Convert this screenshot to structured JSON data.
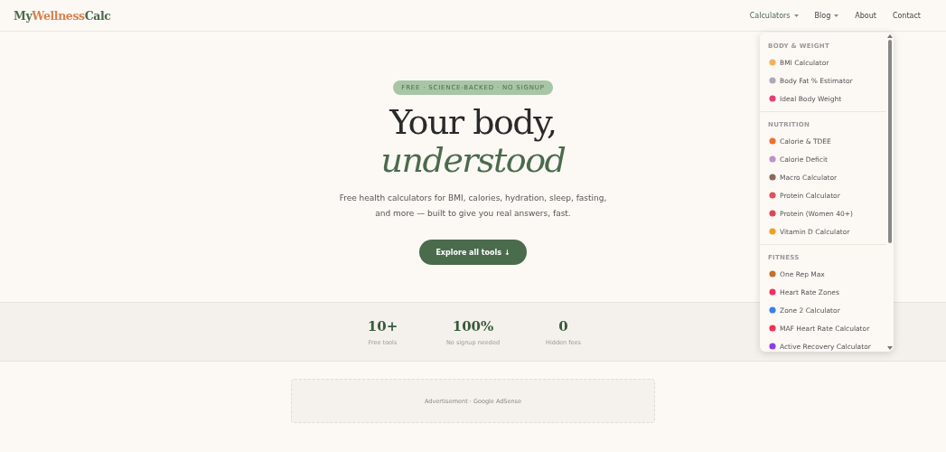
{
  "logo": {
    "parts": [
      {
        "text": "My",
        "color": "#4a6b4c"
      },
      {
        "text": "Wellness",
        "color": "#d9814f"
      },
      {
        "text": "Calc",
        "color": "#4a6b4c"
      }
    ]
  },
  "nav": [
    {
      "label": "Calculators",
      "dropdown": true,
      "expanded": true
    },
    {
      "label": "Blog",
      "dropdown": true,
      "expanded": false
    },
    {
      "label": "About",
      "dropdown": false,
      "expanded": false
    },
    {
      "label": "Contact",
      "dropdown": false,
      "expanded": false
    }
  ],
  "menu": {
    "sections": [
      {
        "heading": "BODY & WEIGHT",
        "items": [
          {
            "label": "BMI Calculator",
            "color": "#f0b060"
          },
          {
            "label": "Body Fat % Estimator",
            "color": "#b0a8b8"
          },
          {
            "label": "Ideal Body Weight",
            "color": "#e0407a"
          }
        ]
      },
      {
        "heading": "NUTRITION",
        "items": [
          {
            "label": "Calorie & TDEE",
            "color": "#f07030"
          },
          {
            "label": "Calorie Deficit",
            "color": "#c090c8"
          },
          {
            "label": "Macro Calculator",
            "color": "#8a6a5a"
          },
          {
            "label": "Protein Calculator",
            "color": "#e05060"
          },
          {
            "label": "Protein (Women 40+)",
            "color": "#d84858"
          },
          {
            "label": "Vitamin D Calculator",
            "color": "#f0a020"
          }
        ]
      },
      {
        "heading": "FITNESS",
        "items": [
          {
            "label": "One Rep Max",
            "color": "#c07030"
          },
          {
            "label": "Heart Rate Zones",
            "color": "#f03060"
          },
          {
            "label": "Zone 2 Calculator",
            "color": "#3a80e8"
          },
          {
            "label": "MAF Heart Rate Calculator",
            "color": "#f03050"
          },
          {
            "label": "Active Recovery Calculator",
            "color": "#8a40e0"
          }
        ]
      }
    ]
  },
  "hero": {
    "badge": "FREE · SCIENCE-BACKED · NO SIGNUP",
    "title": "Your body,",
    "title_accent": "understood",
    "subtitle": "Free health calculators for BMI, calories, hydration, sleep, fasting, and more — built to give you real answers, fast.",
    "button": "Explore all tools ↓"
  },
  "stats": [
    {
      "value": "10+",
      "label": "Free tools"
    },
    {
      "value": "100%",
      "label": "No signup needed"
    },
    {
      "value": "0",
      "label": "Hidden fees"
    }
  ],
  "ad": {
    "label": "Advertisement · Google AdSense"
  }
}
